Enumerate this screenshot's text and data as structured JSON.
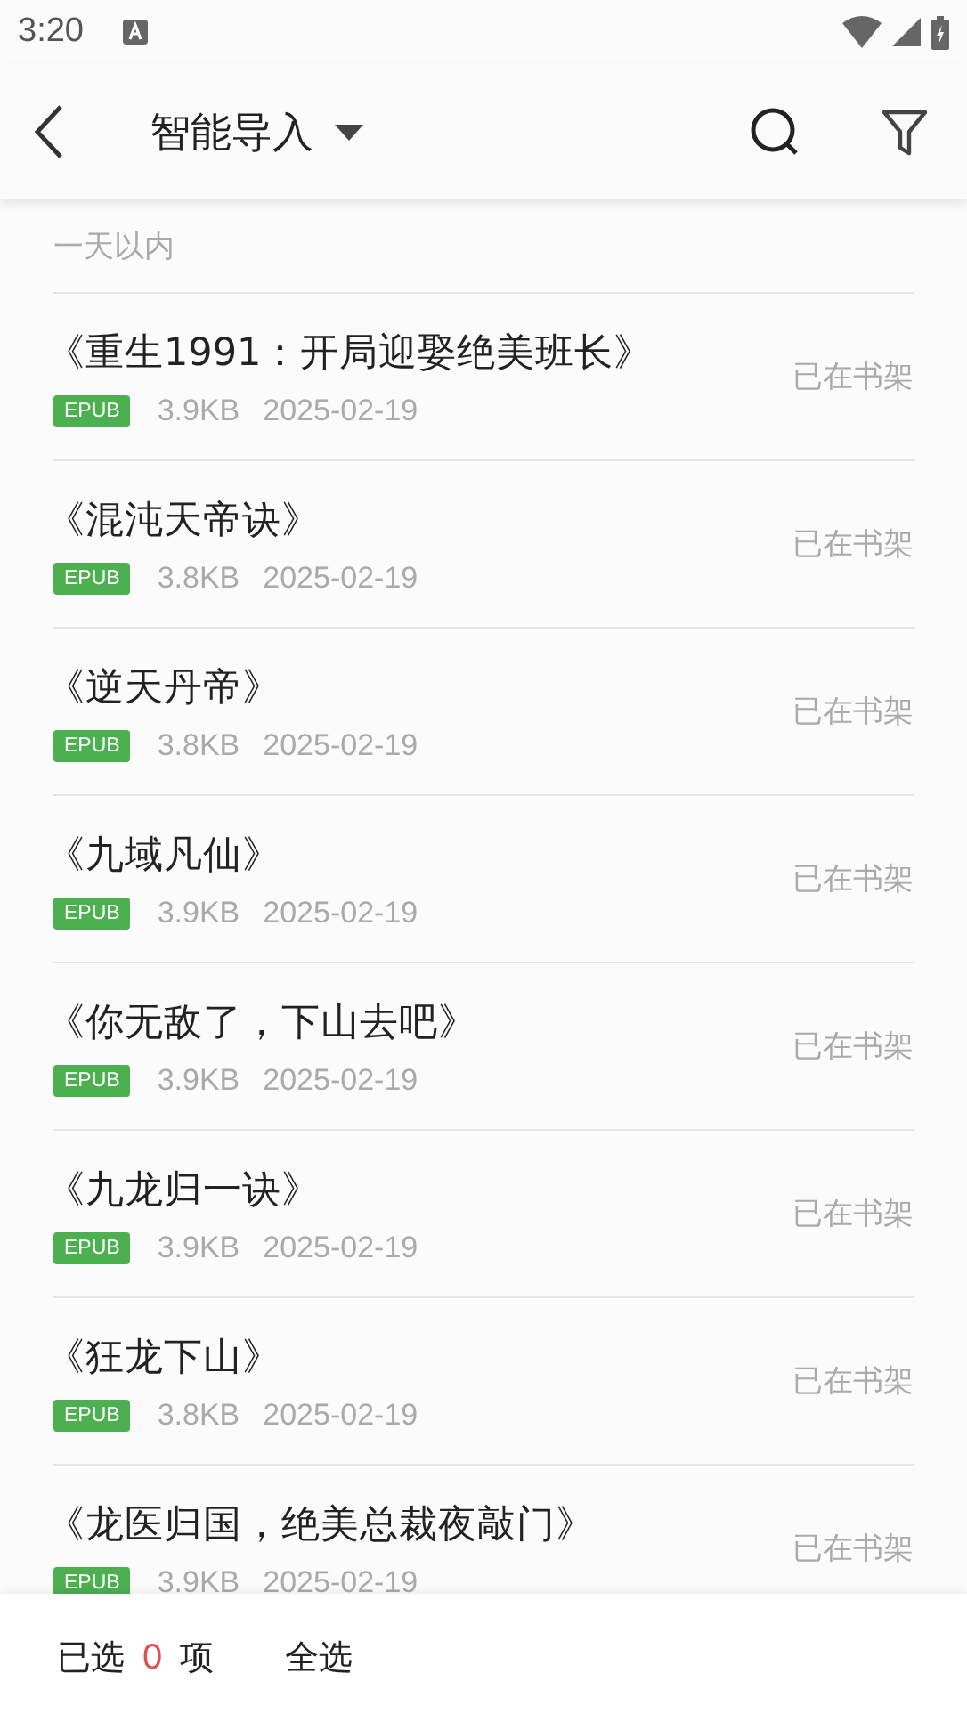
{
  "status_bar": {
    "time": "3:20"
  },
  "app_bar": {
    "title": "智能导入"
  },
  "section": {
    "label": "一天以内"
  },
  "books": [
    {
      "title": "《重生1991：开局迎娶绝美班长》",
      "format": "EPUB",
      "size": "3.9KB",
      "date": "2025-02-19",
      "status": "已在书架"
    },
    {
      "title": "《混沌天帝诀》",
      "format": "EPUB",
      "size": "3.8KB",
      "date": "2025-02-19",
      "status": "已在书架"
    },
    {
      "title": "《逆天丹帝》",
      "format": "EPUB",
      "size": "3.8KB",
      "date": "2025-02-19",
      "status": "已在书架"
    },
    {
      "title": "《九域凡仙》",
      "format": "EPUB",
      "size": "3.9KB",
      "date": "2025-02-19",
      "status": "已在书架"
    },
    {
      "title": "《你无敌了，下山去吧》",
      "format": "EPUB",
      "size": "3.9KB",
      "date": "2025-02-19",
      "status": "已在书架"
    },
    {
      "title": "《九龙归一诀》",
      "format": "EPUB",
      "size": "3.9KB",
      "date": "2025-02-19",
      "status": "已在书架"
    },
    {
      "title": "《狂龙下山》",
      "format": "EPUB",
      "size": "3.8KB",
      "date": "2025-02-19",
      "status": "已在书架"
    },
    {
      "title": "《龙医归国，绝美总裁夜敲门》",
      "format": "EPUB",
      "size": "3.9KB",
      "date": "2025-02-19",
      "status": "已在书架"
    }
  ],
  "bottom_bar": {
    "selected_prefix": "已选",
    "selected_count": "0",
    "selected_suffix": "项",
    "select_all": "全选"
  }
}
